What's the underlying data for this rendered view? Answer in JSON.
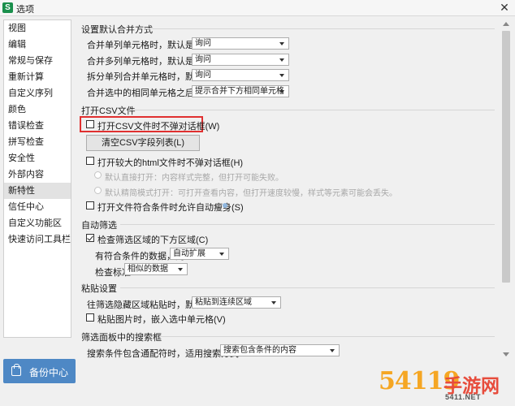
{
  "window": {
    "title": "选项",
    "app_icon": "S",
    "close": "✕"
  },
  "sidebar": {
    "items": [
      {
        "label": "视图"
      },
      {
        "label": "编辑"
      },
      {
        "label": "常规与保存"
      },
      {
        "label": "重新计算"
      },
      {
        "label": "自定义序列"
      },
      {
        "label": "颜色"
      },
      {
        "label": "错误检查"
      },
      {
        "label": "拼写检查"
      },
      {
        "label": "安全性"
      },
      {
        "label": "外部内容"
      },
      {
        "label": "新特性"
      },
      {
        "label": "信任中心"
      },
      {
        "label": "自定义功能区"
      },
      {
        "label": "快速访问工具栏"
      }
    ],
    "selected_index": 10
  },
  "backup": {
    "label": "备份中心",
    "icon": "backup-icon"
  },
  "merge": {
    "title": "设置默认合并方式",
    "rows": [
      {
        "label": "合并单列单元格时，默认是",
        "value": "询问"
      },
      {
        "label": "合并多列单元格时，默认是",
        "value": "询问"
      },
      {
        "label": "拆分单列合并单元格时，默认是",
        "value": "询问"
      },
      {
        "label": "合并选中的相同单元格之后，",
        "value": "提示合并下方相同单元格"
      }
    ]
  },
  "csv": {
    "title": "打开CSV文件",
    "no_dialog_label": "打开CSV文件时不弹对话框(W)",
    "no_dialog_checked": false,
    "clear_button": "清空CSV字段列表(L)",
    "html_label": "打开较大的html文件时不弹对话框(H)",
    "html_checked": false,
    "radio1": "默认直接打开：内容样式完整，但打开可能失败。",
    "radio2": "默认精简模式打开：可打开查看内容，但打开速度较慢，样式等元素可能会丢失。",
    "autoslim_label": "打开文件符合条件时允许自动瘦身(S)",
    "autoslim_checked": false
  },
  "autofilter": {
    "title": "自动筛选",
    "check_label": "检查筛选区域的下方区域(C)",
    "check_checked": true,
    "match_label": "有符合条件的数据，则",
    "match_value": "自动扩展",
    "criteria_label": "检查标准",
    "criteria_value": "相似的数据"
  },
  "paste": {
    "title": "粘贴设置",
    "hidden_label": "往筛选隐藏区域粘贴时，默认是",
    "hidden_value": "粘贴到连续区域",
    "image_label": "粘贴图片时，嵌入选中单元格(V)",
    "image_checked": false
  },
  "search": {
    "title": "筛选面板中的搜索框",
    "wildcard_label": "搜索条件包含通配符时，适用搜索方式:",
    "wildcard_value": "搜索包含条件的内容"
  },
  "watermark": {
    "text": "54119",
    "cn": "手游网",
    "url": "5411.NET"
  },
  "colors": {
    "accent": "#4e88c5",
    "highlight": "#e03030",
    "selected": "#e2e2e2"
  }
}
